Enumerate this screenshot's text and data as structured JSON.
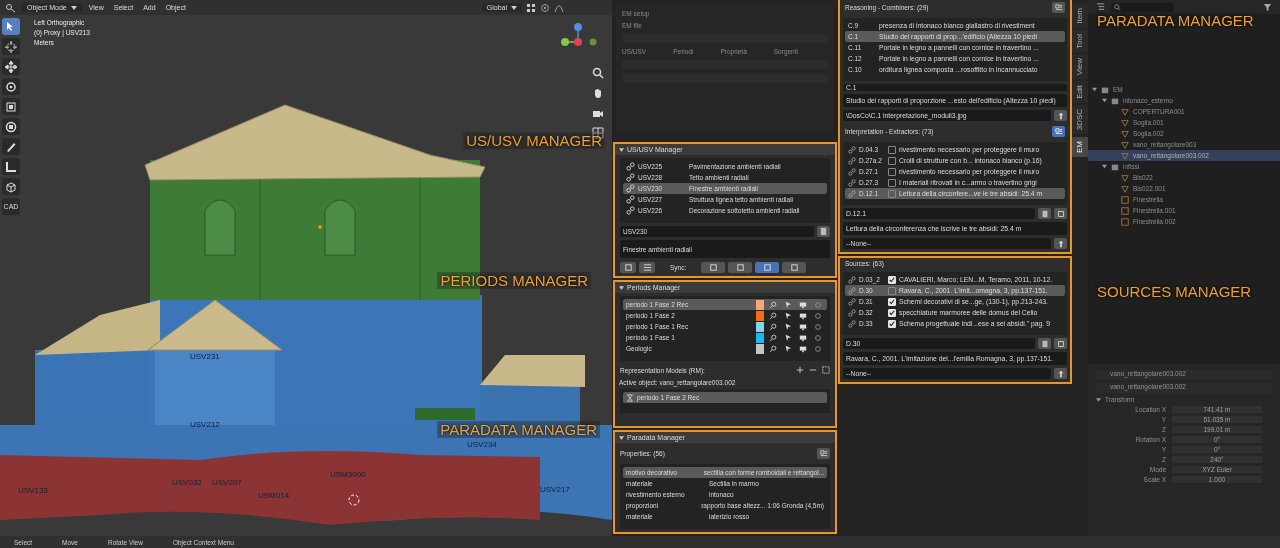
{
  "header": {
    "mode": "Object Mode",
    "menus": [
      "View",
      "Select",
      "Add",
      "Object"
    ],
    "orientation": "Global"
  },
  "viewport": {
    "view_name": "Left Orthographic",
    "object": "(0) Proxy | USV213",
    "units": "Meters",
    "model_labels": [
      "USV231",
      "USV212",
      "USV234",
      "USM3000",
      "USV032",
      "USV207",
      "USM014",
      "USV217",
      "USV133"
    ]
  },
  "tools": [
    {
      "kind": "select",
      "selected": true
    },
    {
      "kind": "cursor",
      "selected": false
    },
    {
      "kind": "move",
      "selected": false
    },
    {
      "kind": "rotate",
      "selected": false
    },
    {
      "kind": "scale",
      "selected": false
    },
    {
      "kind": "transform",
      "selected": false
    },
    {
      "kind": "annotate",
      "selected": false
    },
    {
      "kind": "measure",
      "selected": false
    },
    {
      "kind": "cube",
      "selected": false
    },
    {
      "kind": "cad",
      "label": "CAD",
      "selected": false
    }
  ],
  "annotations": [
    "US/USV MANAGER",
    "PERIODS MANAGER",
    "PARADATA MANAGER",
    "PARADATA MANAGER",
    "SOURCES MANAGER"
  ],
  "em_setup": {
    "title": "EM setup",
    "file_label": "EM file",
    "tabs": [
      "US/USV",
      "Periodi",
      "Proprietà",
      "Sorgenti"
    ]
  },
  "usv_manager": {
    "title": "US/USV Manager",
    "rows": [
      {
        "code": "USV225",
        "description": "Pavimentazione ambienti radiali",
        "selected": false
      },
      {
        "code": "USV228",
        "description": "Tetto ambienti radiali",
        "selected": false
      },
      {
        "code": "USV230",
        "description": "Finestre ambienti radiali",
        "selected": true
      },
      {
        "code": "USV227",
        "description": "Struttura lignea tetto ambienti radiali",
        "selected": false
      },
      {
        "code": "USV226",
        "description": "Decorazione sottotetto ambienti radiali",
        "selected": false
      }
    ],
    "name_field": "USV230",
    "description_field": "Finestre ambienti radiali",
    "sync_label": "Sync:",
    "sync_buttons": [
      {
        "on": false
      },
      {
        "on": false
      },
      {
        "on": true
      },
      {
        "on": false
      }
    ]
  },
  "periods_manager": {
    "title": "Periods Manager",
    "rows": [
      {
        "name": "periodo 1 Fase 2 Rec",
        "color": "#f7a777",
        "selected": true
      },
      {
        "name": "periodo 1 Fase 2",
        "color": "#f26c1a",
        "selected": false
      },
      {
        "name": "periodo 1 Fase 1 Rec",
        "color": "#7fd8f0",
        "selected": false
      },
      {
        "name": "periodo 1 Fase 1",
        "color": "#1bb8ee",
        "selected": false
      },
      {
        "name": "Geologic",
        "color": "#c4c4c4",
        "selected": false
      }
    ],
    "rm_label": "Representation Models (RM):",
    "active_object": "Active object: vano_rettangolare003.002",
    "rm_rows": [
      "periodo 1 Fase 2 Rec"
    ]
  },
  "paradata_manager": {
    "title": "Paradata Manager",
    "count_label": "Properties: (56)",
    "rows": [
      {
        "property": "motivo decorativo",
        "value": "sectilia con forme romboidali e rettangol...",
        "selected": true
      },
      {
        "property": "materiale",
        "value": "Sectilia in marmo",
        "selected": false
      },
      {
        "property": "rivestimento esterno",
        "value": "intonaco",
        "selected": false
      },
      {
        "property": "proporzioni",
        "value": "rapporto base altezz... 1:06 Gronda (4,5m)",
        "selected": false
      },
      {
        "property": "materiale",
        "value": "laterizio rosso",
        "selected": false
      }
    ]
  },
  "reasoning": {
    "label": "Reasoning - Combiners: (29)",
    "rows": [
      {
        "code": "C.9",
        "text": "presenza di intonaco bianco giallastro di rivestiment",
        "selected": false
      },
      {
        "code": "C.1",
        "text": "Studio dei rapporti di prop...'edificio (Altezza 10 piedi",
        "selected": true
      },
      {
        "code": "C.11",
        "text": "Portale in legno a pannelli con cornice in travertino ...",
        "selected": false
      },
      {
        "code": "C.12",
        "text": "Portale in legno a pannelli con cornice in travertino ...",
        "selected": false
      },
      {
        "code": "C.10",
        "text": "orditura lignea composta ...rosoffitto in incannucciato",
        "selected": false
      }
    ],
    "name_field": "C.1",
    "description_field": "Studio dei rapporti di proporzione ...esto dell'edificio (Altezza 10 piedi)",
    "url_field": "\\DosCo\\C.1 interpretazione_moduli3.jpg"
  },
  "extractors": {
    "label": "Interpretation - Extractors: (73)",
    "rows": [
      {
        "code": "D.04.3",
        "text": "rivestimento necessario per proteggere il muro",
        "checked": false,
        "selected": false
      },
      {
        "code": "D.27a.2",
        "text": "Crolli di strutture con b... intonaco bianco (p.16)",
        "checked": false,
        "selected": false
      },
      {
        "code": "D.27.1",
        "text": "rivestimento necessario per proteggere il muro",
        "checked": false,
        "selected": false
      },
      {
        "code": "D.27.3",
        "text": "I materiali ritrovati in c...armo o travertino grigi",
        "checked": false,
        "selected": false
      },
      {
        "code": "D.12.1",
        "text": "Lettura della circonfere...ve le tre absidi: 25.4 m",
        "checked": false,
        "selected": true
      }
    ],
    "name_field": "D.12.1",
    "description_field": "Lettura della circonferenza che iscrive le tre absidi: 25.4 m",
    "url_field": "--None--"
  },
  "sources": {
    "label": "Sources: (63)",
    "rows": [
      {
        "code": "D.03_2",
        "text": "CAVALIERI, Marco; LEN...M, Teramo, 2011, 10-12.",
        "checked": true,
        "selected": false
      },
      {
        "code": "D.30",
        "text": "Ravara, C., 2001. L'imit...omagna, 3, pp.137-151.",
        "checked": false,
        "selected": true
      },
      {
        "code": "D.31",
        "text": "Schemi decorativi di se...ge, (130-1), pp.213-243.",
        "checked": true,
        "selected": false
      },
      {
        "code": "D.32",
        "text": "specchiature marmoree delle domus del Celio",
        "checked": true,
        "selected": false
      },
      {
        "code": "D.33",
        "text": "Schema progettuale indi...ese a sei absidi.\" pag. 9",
        "checked": true,
        "selected": false
      }
    ],
    "name_field": "D.30",
    "description_field": "Ravara, C., 2001. L'imitazione del...l'emilia Romagna, 3, pp.137-151.",
    "url_field": "--None--"
  },
  "sidebar_tabs": [
    {
      "label": "Item",
      "selected": false
    },
    {
      "label": "Tool",
      "selected": false
    },
    {
      "label": "View",
      "selected": false
    },
    {
      "label": "Edit",
      "selected": false
    },
    {
      "label": "3DSC",
      "selected": false
    },
    {
      "label": "EM",
      "selected": true
    }
  ],
  "outliner": {
    "items": [
      {
        "name": "EM",
        "kind": "collection",
        "expanded": true,
        "selected": false,
        "children": [
          {
            "name": "intonaco_esterno",
            "kind": "collection",
            "expanded": true,
            "selected": false,
            "children": [
              {
                "name": "COPERTURA001",
                "kind": "mesh",
                "selected": false
              },
              {
                "name": "Soglia.001",
                "kind": "mesh",
                "selected": false
              },
              {
                "name": "Soglia.002",
                "kind": "mesh",
                "selected": false
              },
              {
                "name": "vano_rettangolare003",
                "kind": "mesh",
                "selected": false
              },
              {
                "name": "vano_rettangolare003.002",
                "kind": "mesh",
                "selected": true
              }
            ]
          },
          {
            "name": "infissi",
            "kind": "collection",
            "expanded": true,
            "selected": false,
            "children": [
              {
                "name": "Bis022",
                "kind": "mesh",
                "selected": false
              },
              {
                "name": "Bis022.001",
                "kind": "mesh",
                "selected": false
              },
              {
                "name": "Finestrella",
                "kind": "empty",
                "selected": false
              },
              {
                "name": "Finestrella.001",
                "kind": "empty",
                "selected": false
              },
              {
                "name": "Finestrella.002",
                "kind": "empty",
                "selected": false
              }
            ]
          }
        ]
      }
    ]
  },
  "properties": {
    "object_name": "vano_rettangolare003.002",
    "mesh_name": "vano_rettangolare003.002",
    "section": "Transform",
    "fields": [
      {
        "label": "Location X",
        "value": "741.41 m"
      },
      {
        "label": "Y",
        "value": "51.035 m"
      },
      {
        "label": "Z",
        "value": "199.01 m"
      },
      {
        "label": "Rotation X",
        "value": "0°"
      },
      {
        "label": "Y",
        "value": "0°"
      },
      {
        "label": "Z",
        "value": "240°"
      },
      {
        "label": "Mode",
        "value": "XYZ Euler"
      },
      {
        "label": "Scale X",
        "value": "1.000"
      }
    ]
  },
  "status_bar": [
    "Select",
    "Move",
    "Rotate View",
    "Object Context Menu"
  ]
}
